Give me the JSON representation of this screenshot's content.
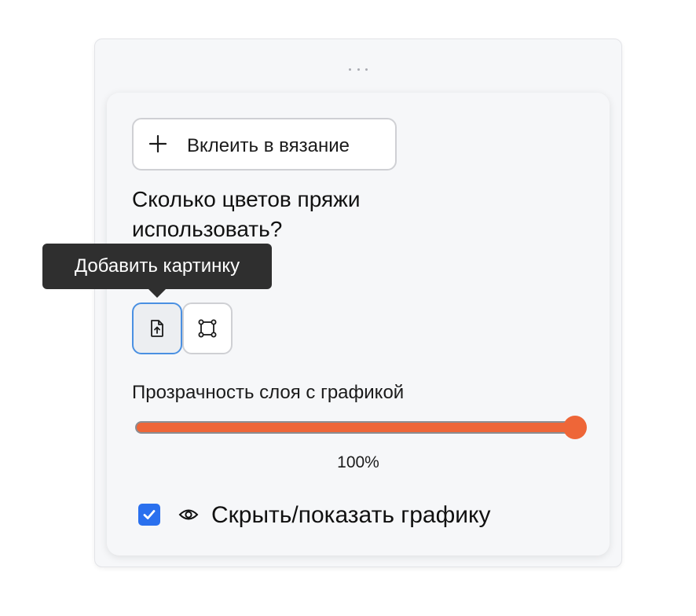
{
  "panel": {
    "paste_button_label": "Вклеить в вязание",
    "question": "Сколько цветов пряжи использовать?"
  },
  "tooltip": {
    "text": "Добавить картинку"
  },
  "toolbar": {
    "buttons": [
      {
        "name": "add-image",
        "icon": "file-upload-icon",
        "active": true
      },
      {
        "name": "select-area",
        "icon": "bounding-box-icon",
        "active": false
      }
    ]
  },
  "opacity": {
    "label": "Прозрачность слоя с графикой",
    "value": 1.0,
    "value_text": "100%"
  },
  "visibility": {
    "checked": true,
    "label": "Скрыть/показать графику",
    "icon": "eye-icon"
  },
  "colors": {
    "accent": "#ee6638",
    "checkbox": "#2a70ee",
    "active_border": "#4a90e2"
  }
}
